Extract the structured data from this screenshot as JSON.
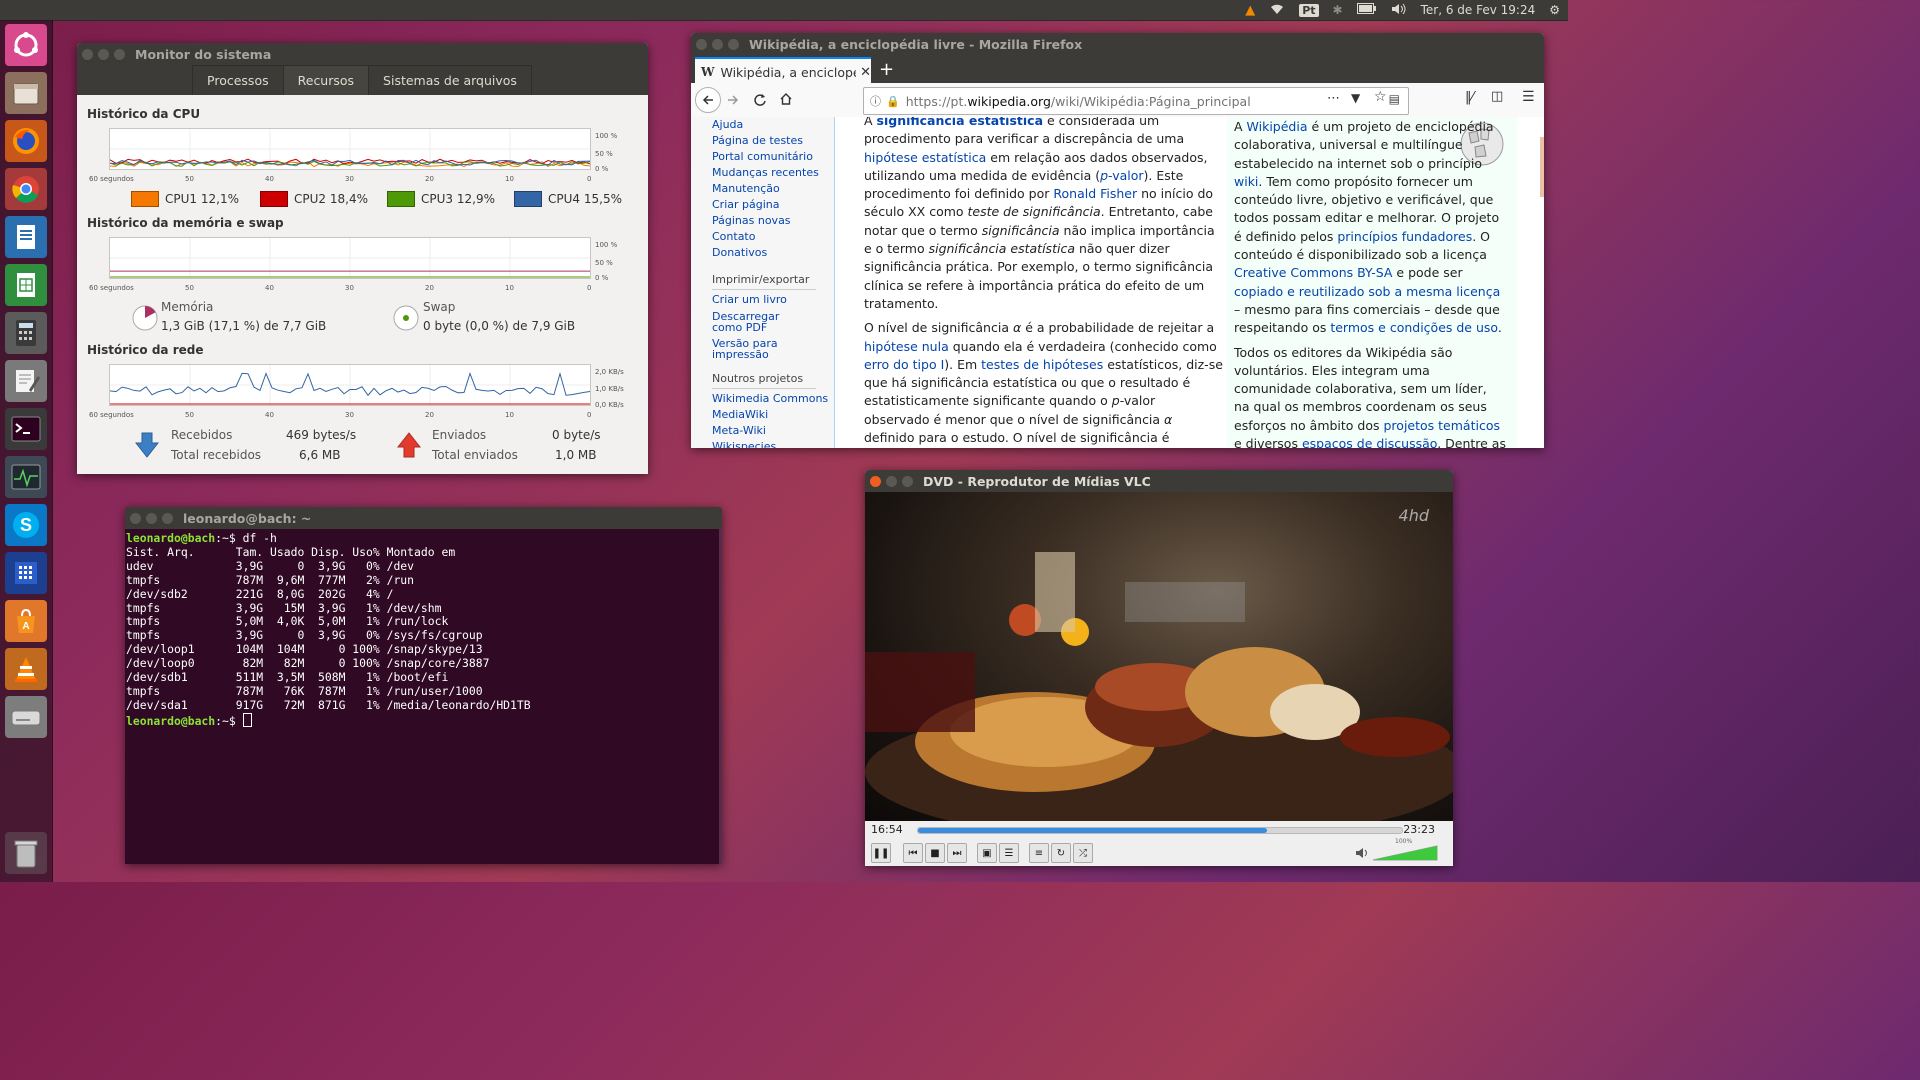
{
  "topbar": {
    "lang": "Pt",
    "clock": "Ter, 6 de Fev 19:24"
  },
  "launcher": {
    "items": [
      "ubuntu-dash-icon",
      "files-icon",
      "firefox-icon",
      "chrome-icon",
      "writer-icon",
      "calc-icon",
      "calculator-icon",
      "text-editor-icon",
      "terminal-icon",
      "system-monitor-icon",
      "skype-icon",
      "remmina-icon",
      "software-center-icon",
      "vlc-icon",
      "drive-icon",
      "trash-icon"
    ]
  },
  "sysmon": {
    "title": "Monitor do sistema",
    "tabs": [
      "Processos",
      "Recursos",
      "Sistemas de arquivos"
    ],
    "cpu": {
      "heading": "Histórico da CPU",
      "y_ticks": [
        "100 %",
        "50 %",
        "0 %"
      ],
      "x_ticks": [
        "60 segundos",
        "50",
        "40",
        "30",
        "20",
        "10",
        "0"
      ],
      "legend": [
        {
          "name": "CPU1",
          "value": "12,1%",
          "color": "#f57900"
        },
        {
          "name": "CPU2",
          "value": "18,4%",
          "color": "#cc0000"
        },
        {
          "name": "CPU3",
          "value": "12,9%",
          "color": "#4e9a06"
        },
        {
          "name": "CPU4",
          "value": "15,5%",
          "color": "#3465a4"
        }
      ]
    },
    "mem": {
      "heading": "Histórico da memória e swap",
      "y_ticks": [
        "100 %",
        "50 %",
        "0 %"
      ],
      "x_ticks": [
        "60 segundos",
        "50",
        "40",
        "30",
        "20",
        "10",
        "0"
      ],
      "memory_label": "Memória",
      "memory_value": "1,3 GiB (17,1 %) de 7,7 GiB",
      "memory_fraction": 0.171,
      "swap_label": "Swap",
      "swap_value": "0 byte (0,0 %) de 7,9 GiB",
      "swap_fraction": 0.0
    },
    "net": {
      "heading": "Histórico da rede",
      "y_ticks": [
        "2,0 KB/s",
        "1,0 KB/s",
        "0,0 KB/s"
      ],
      "x_ticks": [
        "60 segundos",
        "50",
        "40",
        "30",
        "20",
        "10",
        "0"
      ],
      "recv_label": "Recebidos",
      "recv_rate": "469 bytes/s",
      "recv_total_label": "Total recebidos",
      "recv_total": "6,6 MB",
      "sent_label": "Enviados",
      "sent_rate": "0 byte/s",
      "sent_total_label": "Total enviados",
      "sent_total": "1,0 MB"
    }
  },
  "firefox": {
    "title": "Wikipédia, a enciclopédia livre - Mozilla Firefox",
    "tab_label": "Wikipédia, a enciclopédi",
    "url_prefix": "https://pt.",
    "url_domain": "wikipedia.org",
    "url_path": "/wiki/Wikipédia:Página_principal",
    "sidebar": {
      "links1": [
        "Ajuda",
        "Página de testes",
        "Portal comunitário",
        "Mudanças recentes",
        "Manutenção",
        "Criar página",
        "Páginas novas",
        "Contato",
        "Donativos"
      ],
      "print_heading": "Imprimir/exportar",
      "links2": [
        "Criar um livro",
        "Descarregar como PDF",
        "Versão para impressão"
      ],
      "other_heading": "Noutros projetos",
      "links3": [
        "Wikimedia Commons",
        "MediaWiki",
        "Meta-Wiki",
        "Wikispecies"
      ]
    }
  },
  "terminal": {
    "title": "leonardo@bach: ~",
    "prompt": "leonardo@bach",
    "prompt_suffix": ":~$ ",
    "command": "df -h",
    "output": "Sist. Arq.      Tam. Usado Disp. Uso% Montado em\nudev            3,9G     0  3,9G   0% /dev\ntmpfs           787M  9,6M  777M   2% /run\n/dev/sdb2       221G  8,0G  202G   4% /\ntmpfs           3,9G   15M  3,9G   1% /dev/shm\ntmpfs           5,0M  4,0K  5,0M   1% /run/lock\ntmpfs           3,9G     0  3,9G   0% /sys/fs/cgroup\n/dev/loop1      104M  104M     0 100% /snap/skype/13\n/dev/loop0       82M   82M     0 100% /snap/core/3887\n/dev/sdb1       511M  3,5M  508M   1% /boot/efi\ntmpfs           787M   76K  787M   1% /run/user/1000\n/dev/sda1       917G   72M  871G   1% /media/leonardo/HD1TB"
  },
  "vlc": {
    "title": "DVD - Reprodutor de Mídias VLC",
    "elapsed": "16:54",
    "total": "23:23",
    "progress_fraction": 0.722,
    "volume_label": "100%",
    "volume_fraction": 1.0,
    "watermark": "4hd"
  }
}
